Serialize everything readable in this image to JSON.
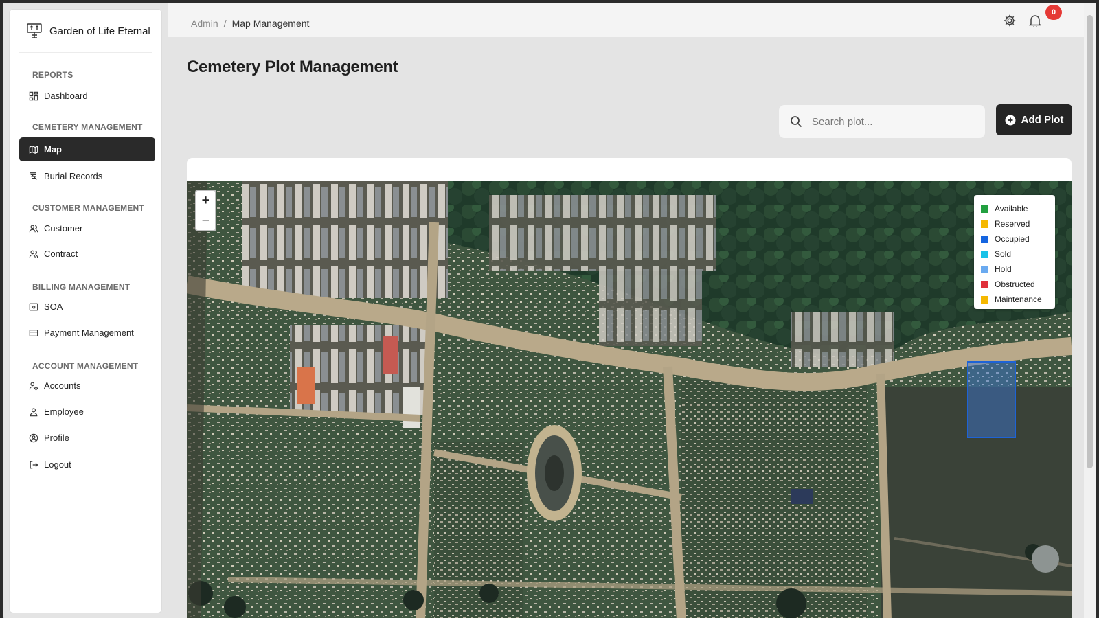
{
  "brand": {
    "name": "Garden of Life Eternal",
    "logo_icon": "tree-logo-icon"
  },
  "sidebar": {
    "sections": [
      {
        "label": "REPORTS"
      },
      {
        "label": "CEMETERY MANAGEMENT"
      },
      {
        "label": "CUSTOMER MANAGEMENT"
      },
      {
        "label": "BILLING MANAGEMENT"
      },
      {
        "label": "ACCOUNT MANAGEMENT"
      }
    ],
    "items": [
      {
        "label": "Dashboard",
        "icon": "dashboard-icon"
      },
      {
        "label": "Map",
        "icon": "map-icon",
        "active": true
      },
      {
        "label": "Burial Records",
        "icon": "burial-records-icon"
      },
      {
        "label": "Customer",
        "icon": "customer-icon"
      },
      {
        "label": "Contract",
        "icon": "contract-icon"
      },
      {
        "label": "SOA",
        "icon": "soa-icon"
      },
      {
        "label": "Payment Management",
        "icon": "payment-icon"
      },
      {
        "label": "Accounts",
        "icon": "accounts-icon"
      },
      {
        "label": "Employee",
        "icon": "employee-icon"
      },
      {
        "label": "Profile",
        "icon": "profile-icon"
      },
      {
        "label": "Logout",
        "icon": "logout-icon"
      }
    ]
  },
  "header": {
    "breadcrumb": [
      "Admin",
      "/",
      "Map Management"
    ],
    "notification_count": "0"
  },
  "main": {
    "title": "Cemetery Plot Management",
    "search_placeholder": "Search plot...",
    "add_button": "Add Plot"
  },
  "map": {
    "zoom_in": "+",
    "zoom_out": "−",
    "legend": [
      {
        "label": "Available",
        "color": "#22a040"
      },
      {
        "label": "Reserved",
        "color": "#f5b800"
      },
      {
        "label": "Occupied",
        "color": "#1565e0"
      },
      {
        "label": "Sold",
        "color": "#19c2e8"
      },
      {
        "label": "Hold",
        "color": "#6aaaf0"
      },
      {
        "label": "Obstructed",
        "color": "#e0303a"
      },
      {
        "label": "Maintenance",
        "color": "#f5b800"
      }
    ]
  },
  "colors": {
    "accent": "#252525",
    "badge": "#e53935",
    "selected_plot": "#1e63d6"
  }
}
